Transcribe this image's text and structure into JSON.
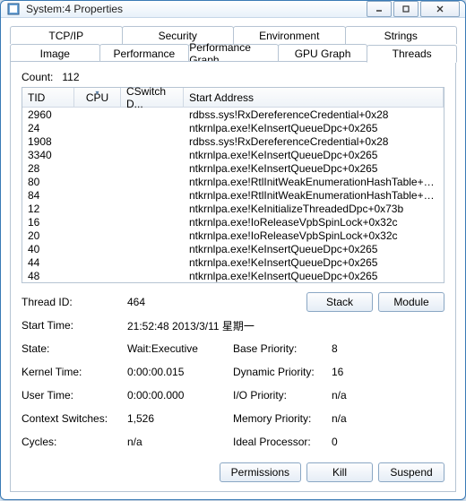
{
  "window": {
    "title": "System:4 Properties"
  },
  "tabs_row1": [
    "TCP/IP",
    "Security",
    "Environment",
    "Strings"
  ],
  "tabs_row2": [
    "Image",
    "Performance",
    "Performance Graph",
    "GPU Graph",
    "Threads"
  ],
  "active_tab": "Threads",
  "count_label": "Count:",
  "count_value": "112",
  "columns": {
    "tid": "TID",
    "cpu": "CPU",
    "cswitch": "CSwitch D...",
    "start": "Start Address"
  },
  "rows": [
    {
      "tid": "2960",
      "start": "rdbss.sys!RxDereferenceCredential+0x28"
    },
    {
      "tid": "24",
      "start": "ntkrnlpa.exe!KeInsertQueueDpc+0x265"
    },
    {
      "tid": "1908",
      "start": "rdbss.sys!RxDereferenceCredential+0x28"
    },
    {
      "tid": "3340",
      "start": "ntkrnlpa.exe!KeInsertQueueDpc+0x265"
    },
    {
      "tid": "28",
      "start": "ntkrnlpa.exe!KeInsertQueueDpc+0x265"
    },
    {
      "tid": "80",
      "start": "ntkrnlpa.exe!RtlInitWeakEnumerationHashTable+0..."
    },
    {
      "tid": "84",
      "start": "ntkrnlpa.exe!RtlInitWeakEnumerationHashTable+0..."
    },
    {
      "tid": "12",
      "start": "ntkrnlpa.exe!KeInitializeThreadedDpc+0x73b"
    },
    {
      "tid": "16",
      "start": "ntkrnlpa.exe!IoReleaseVpbSpinLock+0x32c"
    },
    {
      "tid": "20",
      "start": "ntkrnlpa.exe!IoReleaseVpbSpinLock+0x32c"
    },
    {
      "tid": "40",
      "start": "ntkrnlpa.exe!KeInsertQueueDpc+0x265"
    },
    {
      "tid": "44",
      "start": "ntkrnlpa.exe!KeInsertQueueDpc+0x265"
    },
    {
      "tid": "48",
      "start": "ntkrnlpa.exe!KeInsertQueueDpc+0x265"
    }
  ],
  "details": {
    "thread_id_label": "Thread ID:",
    "thread_id": "464",
    "start_time_label": "Start Time:",
    "start_time": "21:52:48  2013/3/11 星期一",
    "state_label": "State:",
    "state": "Wait:Executive",
    "kernel_time_label": "Kernel Time:",
    "kernel_time": "0:00:00.015",
    "user_time_label": "User Time:",
    "user_time": "0:00:00.000",
    "ctx_label": "Context Switches:",
    "ctx": "1,526",
    "cycles_label": "Cycles:",
    "cycles": "n/a",
    "base_prio_label": "Base Priority:",
    "base_prio": "8",
    "dyn_prio_label": "Dynamic Priority:",
    "dyn_prio": "16",
    "io_prio_label": "I/O Priority:",
    "io_prio": "n/a",
    "mem_prio_label": "Memory Priority:",
    "mem_prio": "n/a",
    "ideal_label": "Ideal Processor:",
    "ideal": "0"
  },
  "buttons": {
    "stack": "Stack",
    "module": "Module",
    "permissions": "Permissions",
    "kill": "Kill",
    "suspend": "Suspend"
  }
}
